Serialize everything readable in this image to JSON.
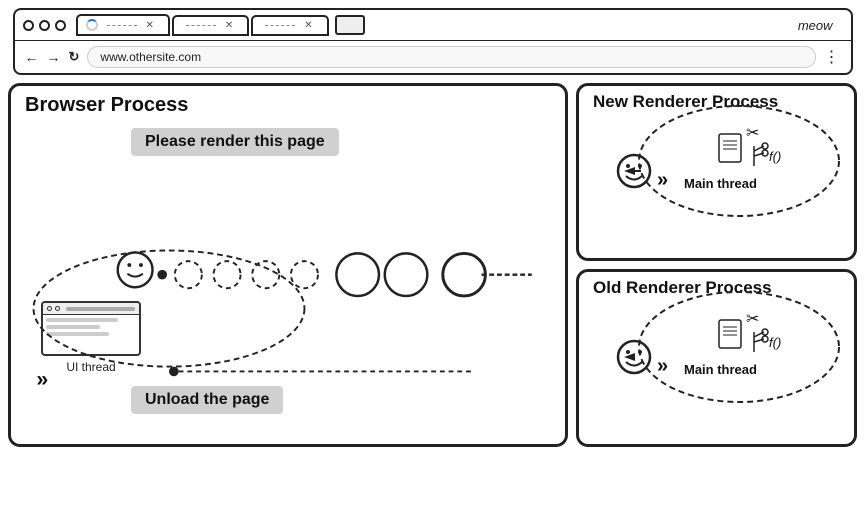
{
  "browser": {
    "tabs": [
      {
        "label": "",
        "has_spinner": true,
        "is_active": true
      },
      {
        "label": "",
        "has_spinner": false
      },
      {
        "label": "",
        "has_spinner": false
      }
    ],
    "meow_label": "meow",
    "address": "www.othersite.com",
    "nav": {
      "back": "←",
      "forward": "→",
      "reload": "c"
    },
    "menu": "⋮"
  },
  "diagram": {
    "browser_process_title": "Browser Process",
    "new_renderer_title": "New Renderer Process",
    "old_renderer_title": "Old Renderer Process",
    "render_message": "Please render this page",
    "unload_message": "Unload the page",
    "ui_thread_label": "UI thread",
    "main_thread_label": "Main thread"
  }
}
